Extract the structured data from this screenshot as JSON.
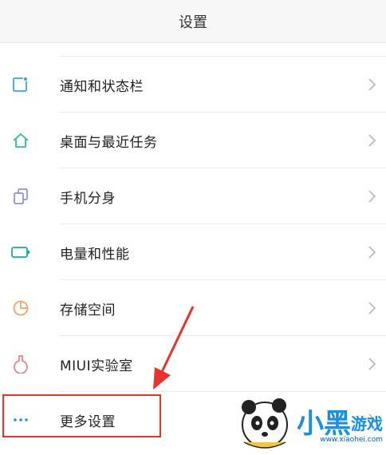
{
  "header": {
    "title": "设置"
  },
  "settings": {
    "items": [
      {
        "label": "通知和状态栏",
        "icon": "notification-icon",
        "color": "#37a9d3"
      },
      {
        "label": "桌面与最近任务",
        "icon": "home-icon",
        "color": "#33b99c"
      },
      {
        "label": "手机分身",
        "icon": "dual-apps-icon",
        "color": "#8b8fd6"
      },
      {
        "label": "电量和性能",
        "icon": "battery-icon",
        "color": "#1fa89a"
      },
      {
        "label": "存储空间",
        "icon": "storage-icon",
        "color": "#f0a36a"
      },
      {
        "label": "MIUI实验室",
        "icon": "flask-icon",
        "color": "#e08a8a"
      },
      {
        "label": "更多设置",
        "icon": "more-icon",
        "color": "#2a8dd8"
      }
    ]
  },
  "annotation": {
    "highlight_color": "#e8332c",
    "highlighted_item": "更多设置"
  },
  "watermark": {
    "text": "www.xiaohei.com",
    "brand": "小黑游戏"
  }
}
